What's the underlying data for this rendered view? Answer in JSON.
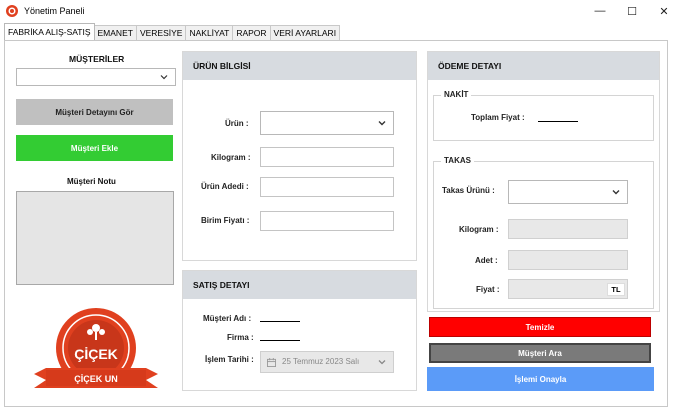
{
  "window": {
    "title": "Yönetim Paneli",
    "minimize_glyph": "—",
    "maximize_glyph": "☐",
    "close_glyph": "✕"
  },
  "tabs": [
    {
      "label": "FABRİKA ALIŞ-SATIŞ",
      "active": true
    },
    {
      "label": "EMANET",
      "active": false
    },
    {
      "label": "VERESİYE",
      "active": false
    },
    {
      "label": "NAKLİYAT",
      "active": false
    },
    {
      "label": "RAPOR",
      "active": false
    },
    {
      "label": "VERİ AYARLARI",
      "active": false
    }
  ],
  "left": {
    "customers_title": "MÜŞTERİLER",
    "customer_detail_button": "Müşteri Detayını Gör",
    "add_customer_button": "Müşteri Ekle",
    "customer_note_title": "Müşteri Notu",
    "logo_name": "ÇİÇEK",
    "logo_banner": "ÇİÇEK UN"
  },
  "product": {
    "header": "ÜRÜN BİLGİSİ",
    "product_label": "Ürün :",
    "kilogram_label": "Kilogram :",
    "quantity_label": "Ürün Adedi :",
    "unit_price_label": "Birim Fiyatı :"
  },
  "sale": {
    "header": "SATIŞ DETAYI",
    "customer_name_label": "Müşteri Adı :",
    "company_label": "Firma :",
    "date_label": "İşlem Tarihi :",
    "date_value": "25 Temmuz 2023 Salı"
  },
  "payment": {
    "header": "ÖDEME DETAYI",
    "cash_group": "NAKİT",
    "total_price_label": "Toplam Fiyat :",
    "trade_group": "TAKAS",
    "trade_product_label": "Takas Ürünü :",
    "kilogram_label": "Kilogram :",
    "quantity_label": "Adet :",
    "price_label": "Fiyat :",
    "currency": "TL"
  },
  "actions": {
    "clear_button": "Temizle",
    "search_customer_button": "Müşteri Ara",
    "confirm_button": "İşlemi Onayla"
  },
  "colors": {
    "add_green": "#33cc33",
    "clear_red": "#ff0000",
    "search_gray": "#7a7a7a",
    "confirm_blue": "#5b9bf8",
    "detail_gray": "#c0c0c0",
    "header_gray": "#d7dbe0",
    "logo_red": "#e0401f"
  }
}
